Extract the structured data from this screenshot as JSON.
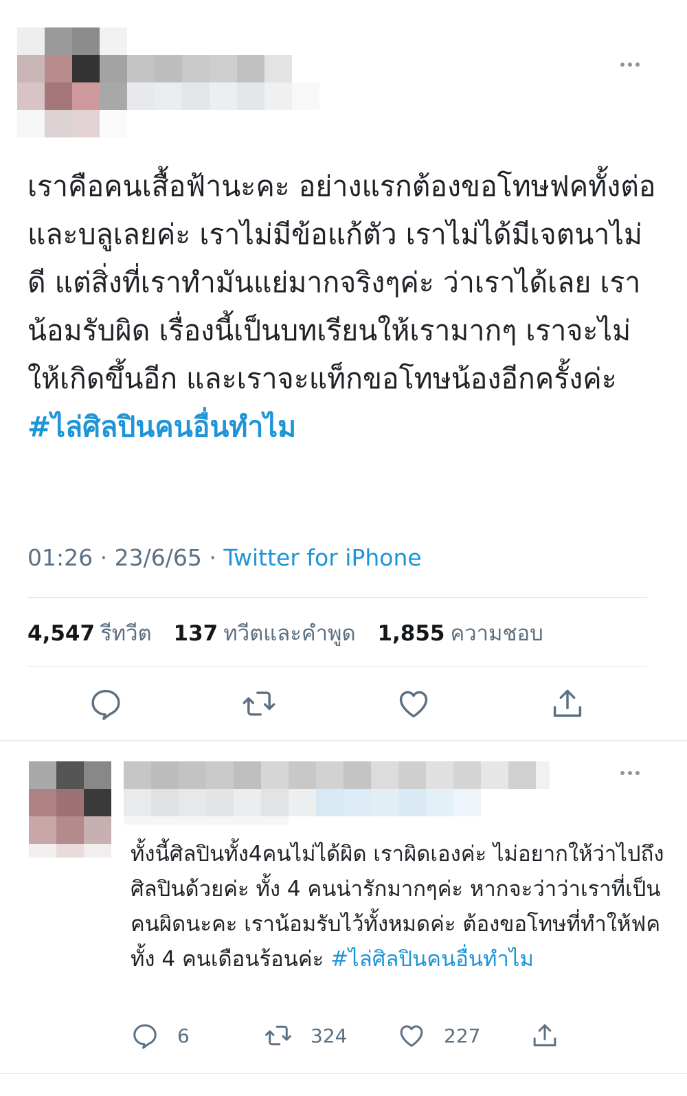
{
  "tweet": {
    "text": "เราคือคนเสื้อฟ้านะคะ อย่างแรกต้องขอโทษฟคทั้งต่อและบลูเลยค่ะ เราไม่มีข้อแก้ตัว เราไม่ได้มีเจตนาไม่ดี  แต่สิ่งที่เราทำมันแย่มากจริงๆค่ะ ว่าเราได้เลย เราน้อมรับผิด เรื่องนี้เป็นบทเรียนให้เรามากๆ เราจะไม่ให้เกิดขึ้นอีก และเราจะแท็กขอโทษน้องอีกครั้งค่ะ ",
    "hashtag": "#ไล่ศิลปินคนอื่นทำไม",
    "time": "01:26",
    "date": "23/6/65",
    "separator": "·",
    "source": "Twitter for iPhone",
    "stats": {
      "retweets_count": "4,547",
      "retweets_label": "รีทวีต",
      "quotes_count": "137",
      "quotes_label": "ทวีตและคำพูด",
      "likes_count": "1,855",
      "likes_label": "ความชอบ"
    }
  },
  "reply": {
    "text": "ทั้งนี้ศิลปินทั้ง4คนไม่ได้ผิด เราผิดเองค่ะ ไม่อยากให้ว่าไปถึงศิลปินด้วยค่ะ ทั้ง 4 คนน่ารักมากๆค่ะ หากจะว่าว่าเราที่เป็นคนผิดนะคะ เราน้อมรับไว้ทั้งหมดค่ะ ต้องขอโทษที่ทำให้ฟคทั้ง 4 คนเดือนร้อนค่ะ ",
    "hashtag": "#ไล่ศิลปินคนอื่นทำไม",
    "reply_count": "6",
    "retweet_count": "324",
    "like_count": "227"
  },
  "icons": {
    "reply": "reply-icon",
    "retweet": "retweet-icon",
    "like": "heart-icon",
    "share": "share-icon",
    "more": "more-icon"
  },
  "colors": {
    "accent": "#1d95d8",
    "secondary_text": "#5b7083",
    "divider": "#e1e8ed"
  }
}
